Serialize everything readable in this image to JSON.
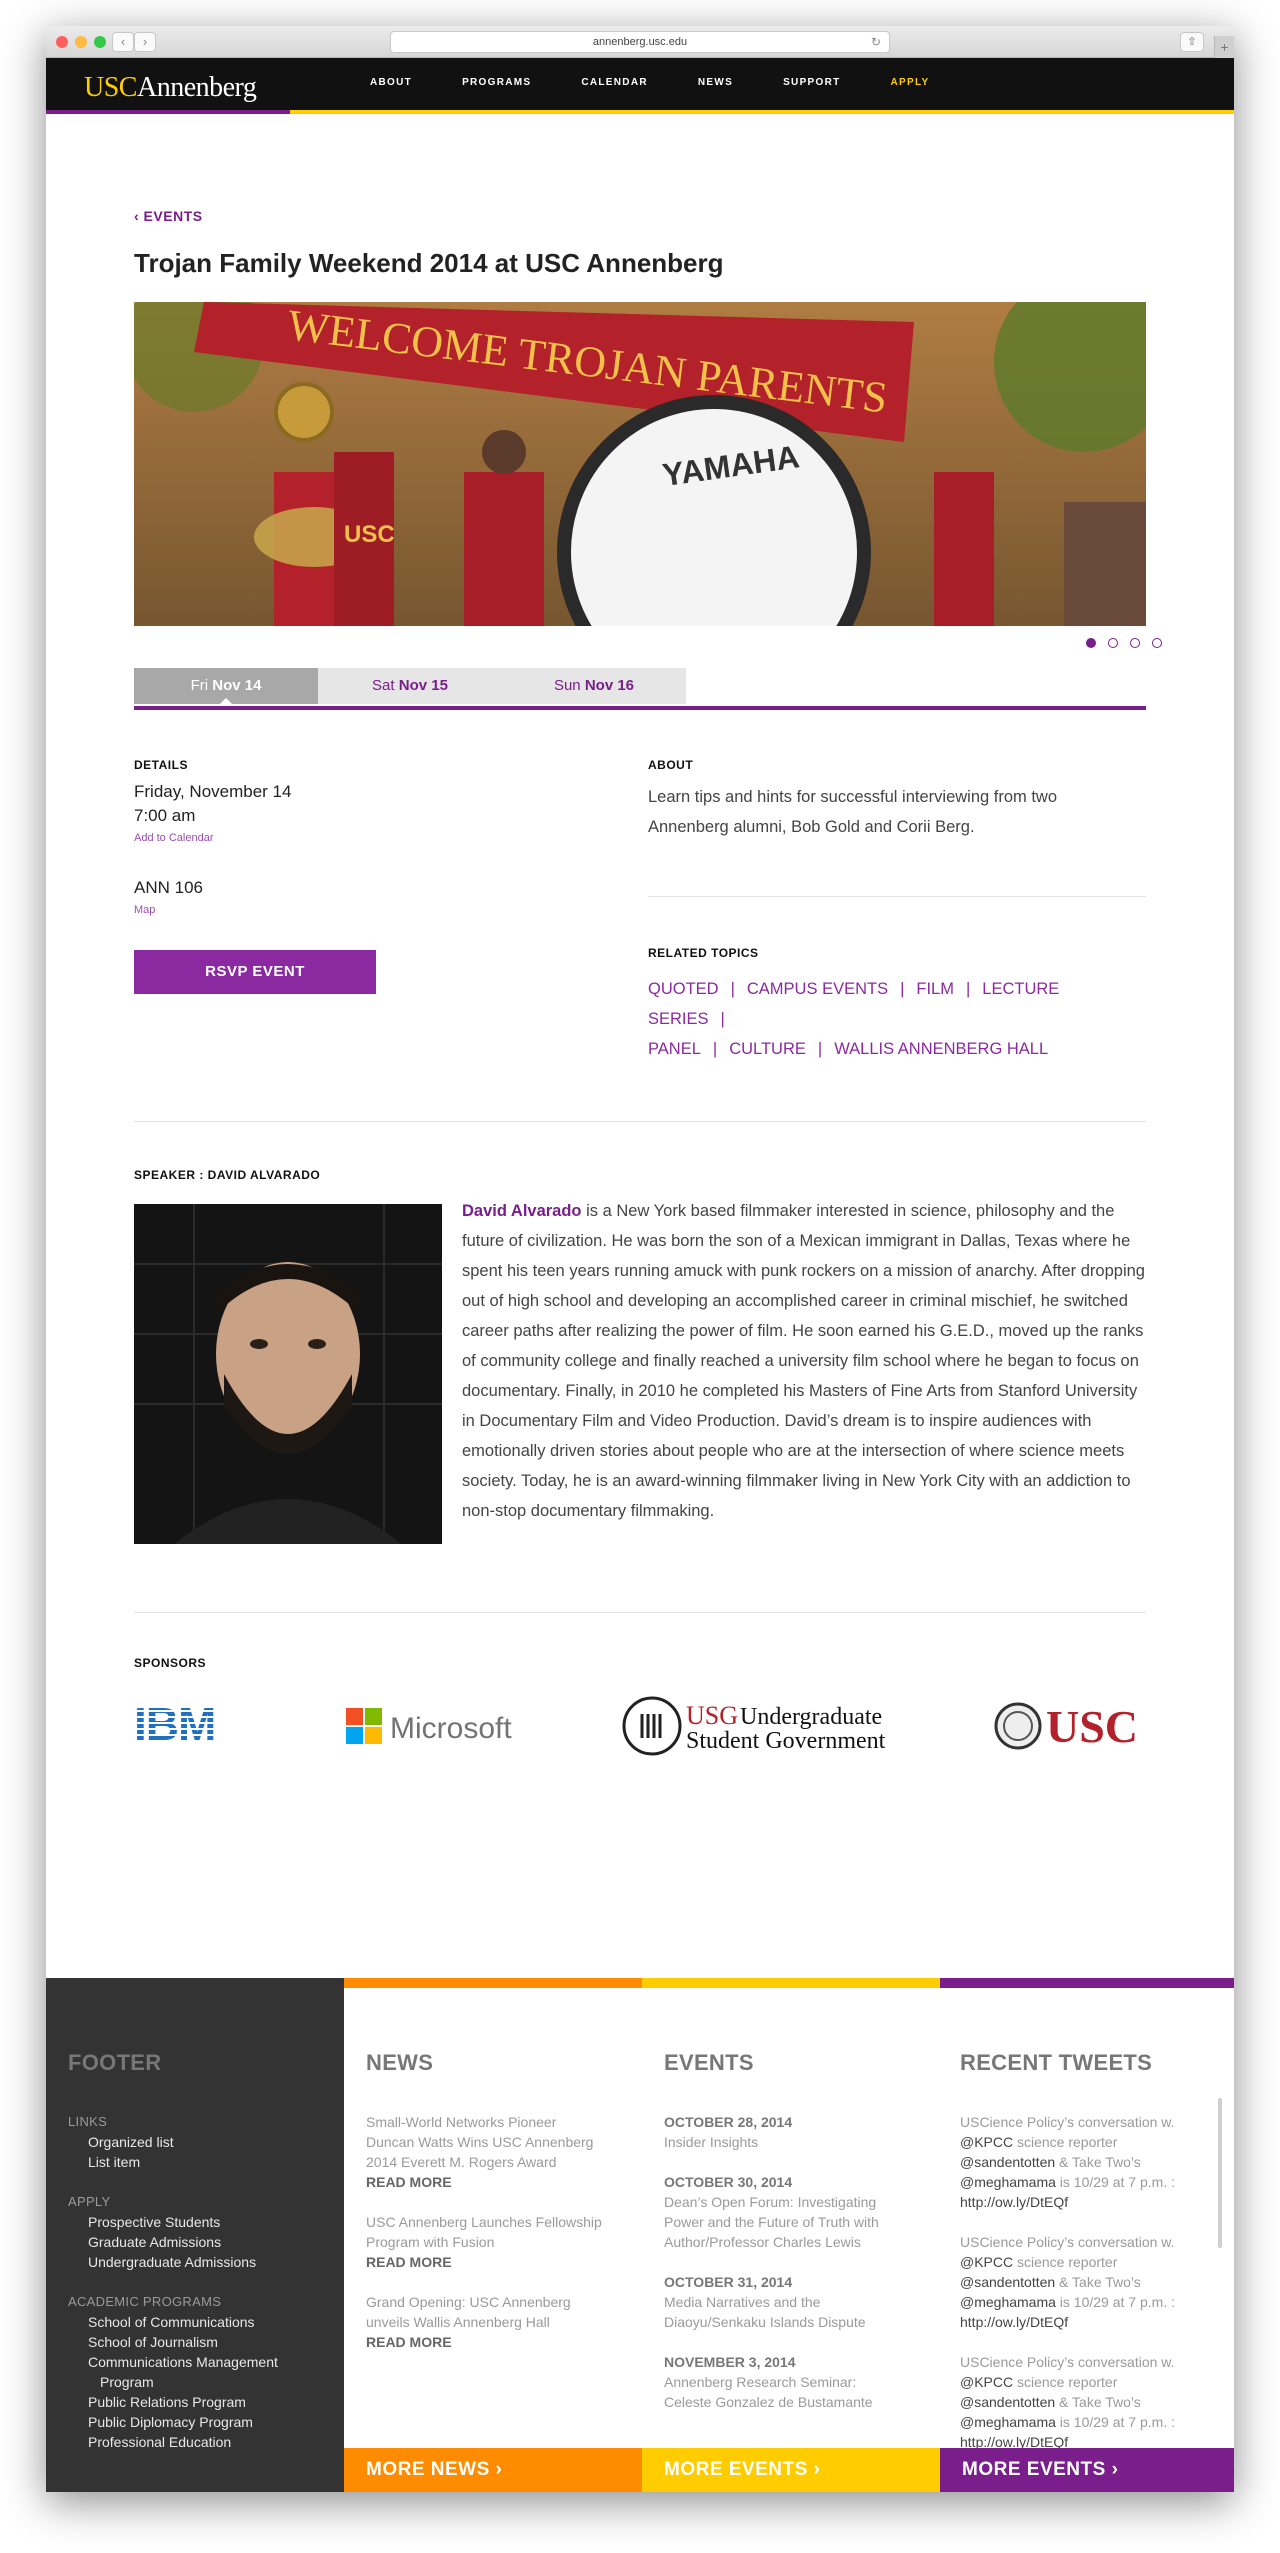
{
  "browser": {
    "url": "annenberg.usc.edu"
  },
  "header": {
    "logo_usc": "USC",
    "logo_name": "Annenberg",
    "nav": [
      "ABOUT",
      "PROGRAMS",
      "CALENDAR",
      "NEWS",
      "SUPPORT",
      "APPLY"
    ]
  },
  "breadcrumb": "‹ EVENTS",
  "page_title": "Trojan Family Weekend 2014 at USC Annenberg",
  "hero": {
    "banner_text": "WELCOME TROJAN PARENTS",
    "drum_text": "YAMAHA",
    "shirt_text": "USC"
  },
  "day_tabs": [
    {
      "day": "Fri",
      "date": "Nov 14"
    },
    {
      "day": "Sat",
      "date": "Nov 15"
    },
    {
      "day": "Sun",
      "date": "Nov 16"
    }
  ],
  "details": {
    "heading": "DETAILS",
    "date": "Friday, November 14",
    "time": "7:00 am",
    "add_calendar": "Add to Calendar",
    "room": "ANN 106",
    "map": "Map",
    "rsvp": "RSVP EVENT"
  },
  "about": {
    "heading": "ABOUT",
    "text": "Learn tips and hints for successful interviewing from two Annenberg alumni, Bob Gold and Corii Berg."
  },
  "related": {
    "heading": "RELATED TOPICS",
    "topics": [
      "QUOTED",
      "CAMPUS EVENTS",
      "FILM",
      "LECTURE SERIES",
      "PANEL",
      "CULTURE",
      "WALLIS ANNENBERG HALL"
    ]
  },
  "speaker": {
    "heading": "SPEAKER : DAVID ALVARADO",
    "name": "David Alvarado",
    "bio": " is a New York based filmmaker interested in science, philosophy and the future of civilization. He was born the son of a Mexican immigrant in Dallas, Texas where he spent his teen years running amuck with punk rockers on a mission of anarchy. After dropping out of high school and developing an accomplished career in criminal mischief, he switched career paths after realizing the power of film. He soon earned his G.E.D., moved up the ranks of community college and finally reached a university film school where he began to focus on documentary. Finally, in 2010 he completed his Masters of Fine Arts from Stanford University in Documentary Film and Video Production. David’s dream is to inspire audiences with emotionally driven stories about people who are at the intersection of where science meets society. Today, he is an award-winning filmmaker living in New York City with an addiction to non-stop documentary filmmaking."
  },
  "sponsors": {
    "heading": "SPONSORS",
    "ibm": "IBM",
    "microsoft": "Microsoft",
    "usg_abbr": "USG",
    "usg_line1": "Undergraduate",
    "usg_line2": "Student Government",
    "usc": "USC"
  },
  "footer": {
    "title": "FOOTER",
    "links_h": "LINKS",
    "links": [
      "Organized list",
      "List item"
    ],
    "apply_h": "APPLY",
    "apply": [
      "Prospective Students",
      "Graduate Admissions",
      "Undergraduate Admissions"
    ],
    "academic_h": "ACADEMIC PROGRAMS",
    "academic": [
      "School of Communications",
      "School of Journalism",
      "Communications Management",
      "Program",
      "Public Relations Program",
      "Public Diplomacy Program",
      "Professional Education"
    ],
    "news_h": "NEWS",
    "news": [
      {
        "title": "Small-World Networks Pioneer Duncan Watts Wins USC Annenberg 2014 Everett M. Rogers Award",
        "more": "READ MORE"
      },
      {
        "title": "USC Annenberg Launches Fellowship Program with Fusion",
        "more": "READ MORE"
      },
      {
        "title": "Grand Opening: USC Annenberg unveils Wallis Annenberg Hall",
        "more": "READ MORE"
      }
    ],
    "events_h": "EVENTS",
    "events": [
      {
        "date": "OCTOBER 28, 2014",
        "title": "Insider Insights"
      },
      {
        "date": "OCTOBER 30, 2014",
        "title": "Dean’s Open Forum: Investigating Power and the Future of Truth with Author/Professor Charles Lewis"
      },
      {
        "date": "OCTOBER 31, 2014",
        "title": "Media Narratives and the Diaoyu/Senkaku Islands Dispute"
      },
      {
        "date": "NOVEMBER 3, 2014",
        "title": "Annenberg Research Seminar: Celeste Gonzalez de Bustamante"
      }
    ],
    "tweets_h": "RECENT TWEETS",
    "tweet": {
      "l1": "USCience Policy’s conversation w.",
      "l2a": "@KPCC",
      "l2b": " science reporter",
      "l3a": "@sandentotten",
      "l3b": " & Take Two’s",
      "l4a": "@meghamama",
      "l4b": " is 10/29 at 7 p.m. :",
      "l5": "http://ow.ly/DtEQf"
    },
    "more_news": "MORE NEWS ›",
    "more_events": "MORE EVENTS ›",
    "more_events2": "MORE EVENTS ›"
  },
  "colors": {
    "cardinal": "#7a1e8c",
    "gold": "#ffcc00",
    "orange": "#ff8c00",
    "footer_dark": "#333333"
  }
}
